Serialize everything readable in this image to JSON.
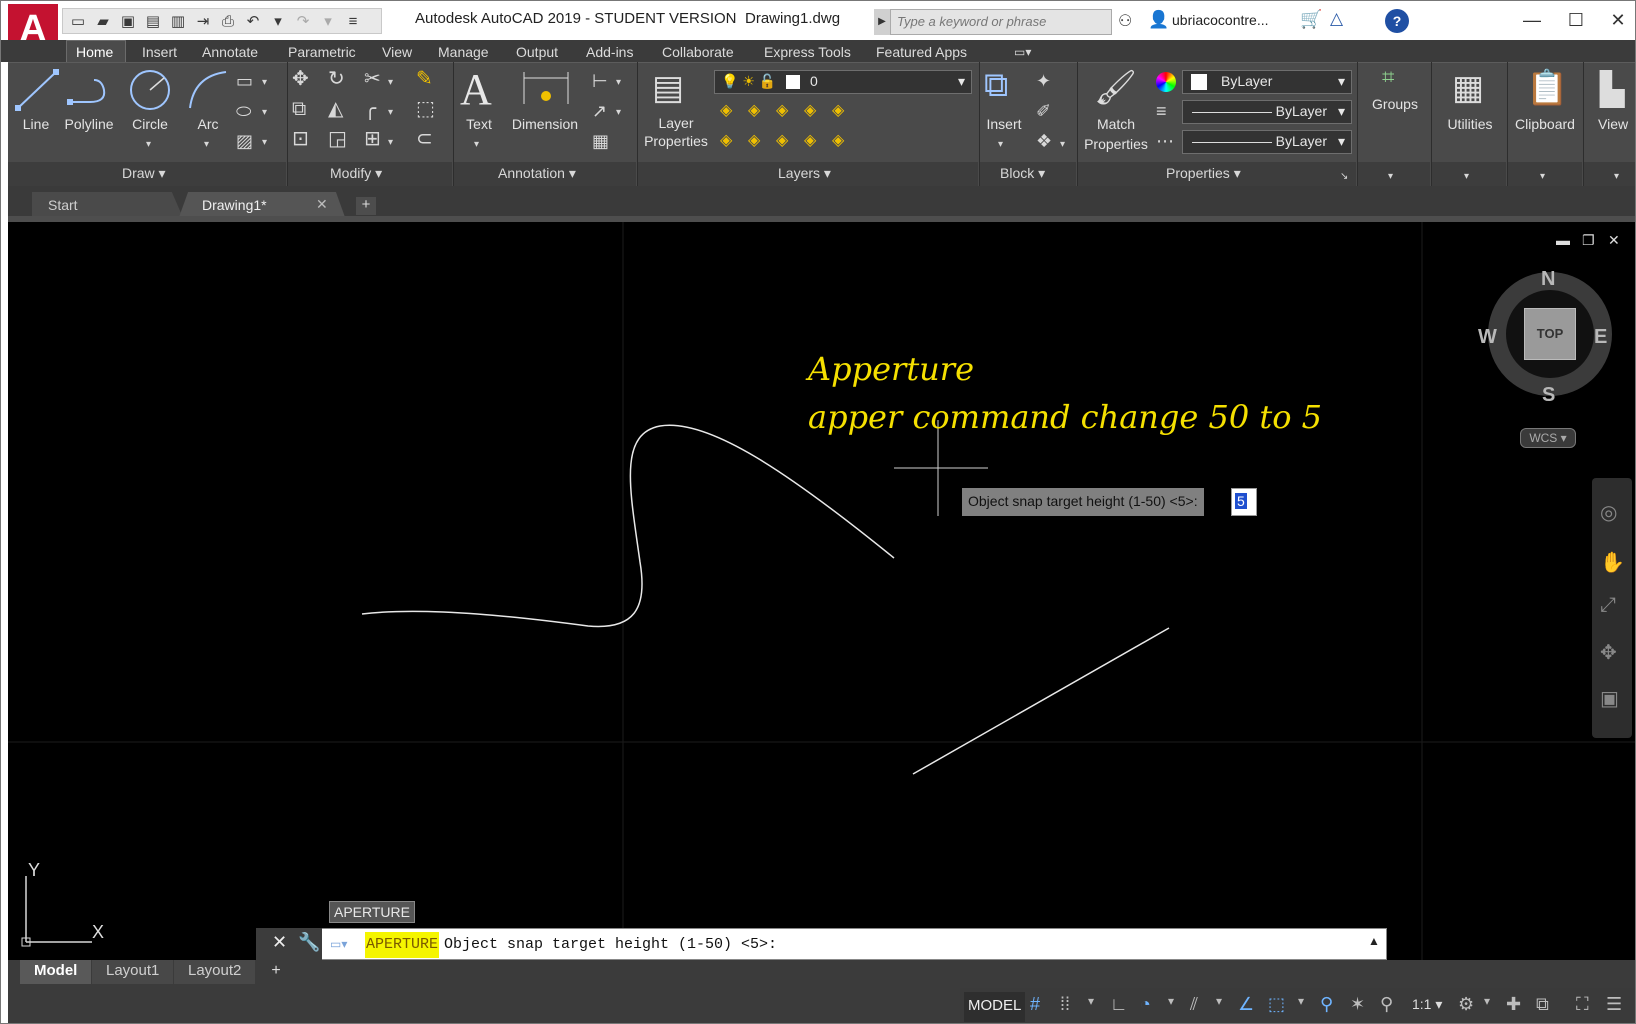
{
  "titlebar": {
    "app_logo": "A",
    "title": "Autodesk AutoCAD 2019 - STUDENT VERSION",
    "filename": "Drawing1.dwg",
    "search_placeholder": "Type a keyword or phrase",
    "username": "ubriacocontre..."
  },
  "ribbon_tabs": [
    "Home",
    "Insert",
    "Annotate",
    "Parametric",
    "View",
    "Manage",
    "Output",
    "Add-ins",
    "Collaborate",
    "Express Tools",
    "Featured Apps"
  ],
  "ribbon": {
    "draw": {
      "title": "Draw",
      "line": "Line",
      "polyline": "Polyline",
      "circle": "Circle",
      "arc": "Arc"
    },
    "modify": {
      "title": "Modify"
    },
    "annotation": {
      "title": "Annotation",
      "text": "Text",
      "dimension": "Dimension"
    },
    "layers": {
      "title": "Layers",
      "layer_properties_1": "Layer",
      "layer_properties_2": "Properties",
      "current_layer": "0"
    },
    "block": {
      "title": "Block",
      "insert": "Insert"
    },
    "properties": {
      "title": "Properties",
      "match_1": "Match",
      "match_2": "Properties",
      "color": "ByLayer",
      "linetype": "ByLayer",
      "lineweight": "ByLayer"
    },
    "groups": "Groups",
    "utilities": "Utilities",
    "clipboard": "Clipboard",
    "view": "View"
  },
  "file_tabs": {
    "start": "Start",
    "drawing": "Drawing1*"
  },
  "canvas": {
    "annotation_line1": "Apperture",
    "annotation_line2": "apper command change 50 to 5",
    "dynamic_prompt": "Object snap target height (1-50) <5>:",
    "dynamic_input": "5",
    "viewcube": {
      "face": "TOP",
      "n": "N",
      "s": "S",
      "e": "E",
      "w": "W",
      "wcs": "WCS"
    },
    "ucs_x": "X",
    "ucs_y": "Y"
  },
  "command_line": {
    "tooltip": "APERTURE",
    "command_name": "APERTURE",
    "prompt": "Object snap target height (1-50) <5>:"
  },
  "layout_tabs": [
    "Model",
    "Layout1",
    "Layout2"
  ],
  "status_bar": {
    "model": "MODEL",
    "scale": "1:1"
  }
}
